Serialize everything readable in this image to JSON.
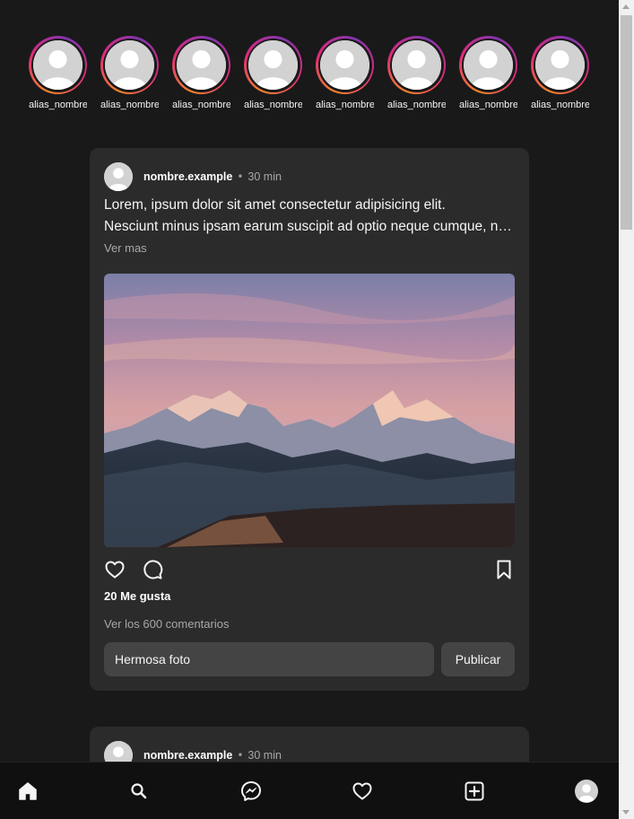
{
  "stories": [
    {
      "label": "alias_nombre"
    },
    {
      "label": "alias_nombre"
    },
    {
      "label": "alias_nombre"
    },
    {
      "label": "alias_nombre"
    },
    {
      "label": "alias_nombre"
    },
    {
      "label": "alias_nombre"
    },
    {
      "label": "alias_nombre"
    },
    {
      "label": "alias_nombre"
    }
  ],
  "posts": [
    {
      "username": "nombre.example",
      "separator": "•",
      "time": "30 min",
      "text_line1": "Lorem, ipsum dolor sit amet consectetur adipisicing elit.",
      "text_line2": "Nesciunt minus ipsam earum suscipit ad optio neque cumque, natus quos tempore.",
      "see_more": "Ver mas",
      "likes": "20 Me gusta",
      "view_comments": "Ver los 600 comentarios",
      "comment_value": "Hermosa foto",
      "publish_label": "Publicar"
    },
    {
      "username": "nombre.example",
      "separator": "•",
      "time": "30 min"
    }
  ],
  "bottom_nav": {
    "items": [
      "home-icon",
      "search-icon",
      "messenger-icon",
      "heart-icon",
      "add-post-icon",
      "profile-avatar"
    ]
  },
  "colors": {
    "background": "#191919",
    "card": "#2b2b2b",
    "input": "#444444",
    "muted_text": "#a8a8a8"
  }
}
